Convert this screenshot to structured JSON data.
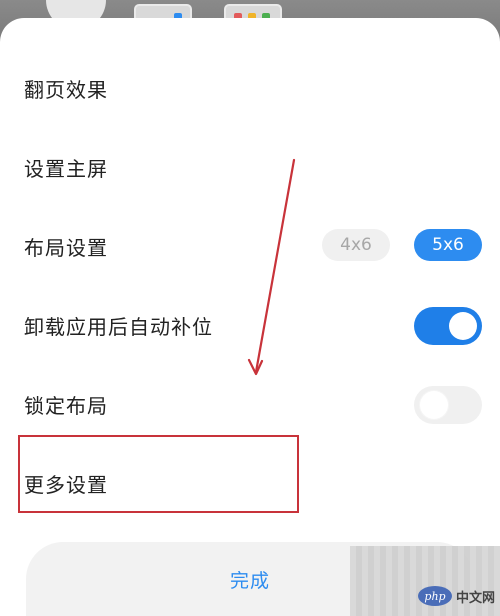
{
  "menu": {
    "items": [
      {
        "label": "翻页效果"
      },
      {
        "label": "设置主屏"
      },
      {
        "label": "布局设置",
        "options": [
          "4x6",
          "5x6"
        ],
        "selected": "5x6"
      },
      {
        "label": "卸载应用后自动补位",
        "toggle": true
      },
      {
        "label": "锁定布局",
        "toggle": false
      },
      {
        "label": "更多设置"
      }
    ]
  },
  "footer": {
    "done_label": "完成"
  },
  "watermark": {
    "logo": "php",
    "text": "中文网"
  },
  "colors": {
    "accent": "#2d8cf0",
    "toggle_on": "#1f7fe8",
    "annotation_red": "#c8333a"
  }
}
